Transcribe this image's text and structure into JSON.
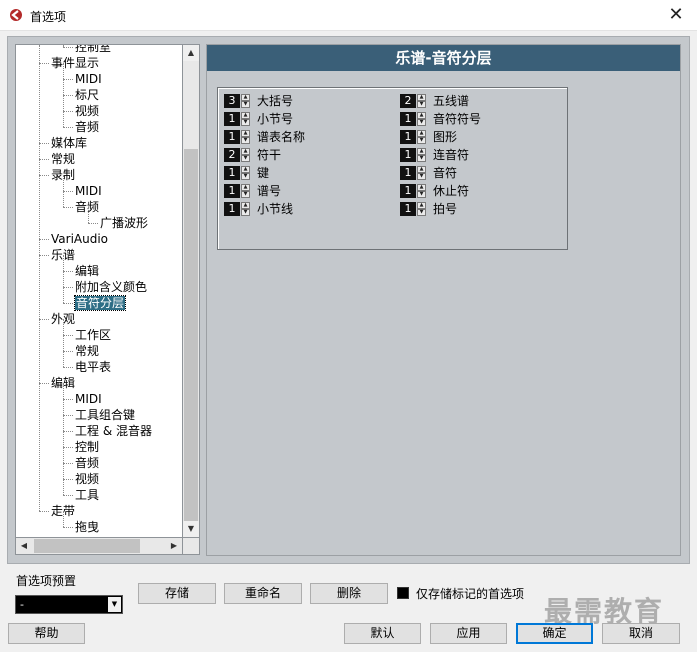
{
  "window": {
    "title": "首选项",
    "close_glyph": "✕"
  },
  "tree": {
    "items": [
      {
        "label": "控制室",
        "level": 2
      },
      {
        "label": "事件显示",
        "level": 1
      },
      {
        "label": "MIDI",
        "level": 2
      },
      {
        "label": "标尺",
        "level": 2
      },
      {
        "label": "视频",
        "level": 2
      },
      {
        "label": "音频",
        "level": 2
      },
      {
        "label": "媒体库",
        "level": 1
      },
      {
        "label": "常规",
        "level": 1
      },
      {
        "label": "录制",
        "level": 1
      },
      {
        "label": "MIDI",
        "level": 2
      },
      {
        "label": "音频",
        "level": 2
      },
      {
        "label": "广播波形",
        "level": 3
      },
      {
        "label": "VariAudio",
        "level": 1
      },
      {
        "label": "乐谱",
        "level": 1
      },
      {
        "label": "编辑",
        "level": 2
      },
      {
        "label": "附加含义颜色",
        "level": 2
      },
      {
        "label": "音符分层",
        "level": 2,
        "selected": true
      },
      {
        "label": "外观",
        "level": 1
      },
      {
        "label": "工作区",
        "level": 2
      },
      {
        "label": "常规",
        "level": 2
      },
      {
        "label": "电平表",
        "level": 2
      },
      {
        "label": "编辑",
        "level": 1
      },
      {
        "label": "MIDI",
        "level": 2
      },
      {
        "label": "工具组合键",
        "level": 2
      },
      {
        "label": "工程 & 混音器",
        "level": 2
      },
      {
        "label": "控制",
        "level": 2
      },
      {
        "label": "音频",
        "level": 2
      },
      {
        "label": "视频",
        "level": 2
      },
      {
        "label": "工具",
        "level": 2
      },
      {
        "label": "走带",
        "level": 1
      },
      {
        "label": "拖曳",
        "level": 2
      }
    ]
  },
  "panel": {
    "header": "乐谱-音符分层",
    "left_column": [
      {
        "value": "3",
        "label": "大括号"
      },
      {
        "value": "1",
        "label": "小节号"
      },
      {
        "value": "1",
        "label": "谱表名称"
      },
      {
        "value": "2",
        "label": "符干"
      },
      {
        "value": "1",
        "label": "键"
      },
      {
        "value": "1",
        "label": "谱号"
      },
      {
        "value": "1",
        "label": "小节线"
      }
    ],
    "right_column": [
      {
        "value": "2",
        "label": "五线谱"
      },
      {
        "value": "1",
        "label": "音符符号"
      },
      {
        "value": "1",
        "label": "图形"
      },
      {
        "value": "1",
        "label": "连音符"
      },
      {
        "value": "1",
        "label": "音符"
      },
      {
        "value": "1",
        "label": "休止符"
      },
      {
        "value": "1",
        "label": "拍号"
      }
    ]
  },
  "presets": {
    "label": "首选项预置",
    "selected": "-",
    "store_button": "存储",
    "rename_button": "重命名",
    "delete_button": "删除",
    "marked_only_label": "仅存储标记的首选项"
  },
  "footer": {
    "help_button": "帮助",
    "default_button": "默认",
    "apply_button": "应用",
    "ok_button": "确定",
    "cancel_button": "取消"
  },
  "watermark": "最需教育",
  "colors": {
    "header_bg": "#3a5f78",
    "panel_bg": "#c4c8cc",
    "selected_item": "#2e6e86"
  },
  "icons": {
    "app": "app-logo-icon",
    "scroll_up": "▲",
    "scroll_down": "▼",
    "scroll_left": "◀",
    "scroll_right": "▶",
    "dropdown": "▼"
  }
}
